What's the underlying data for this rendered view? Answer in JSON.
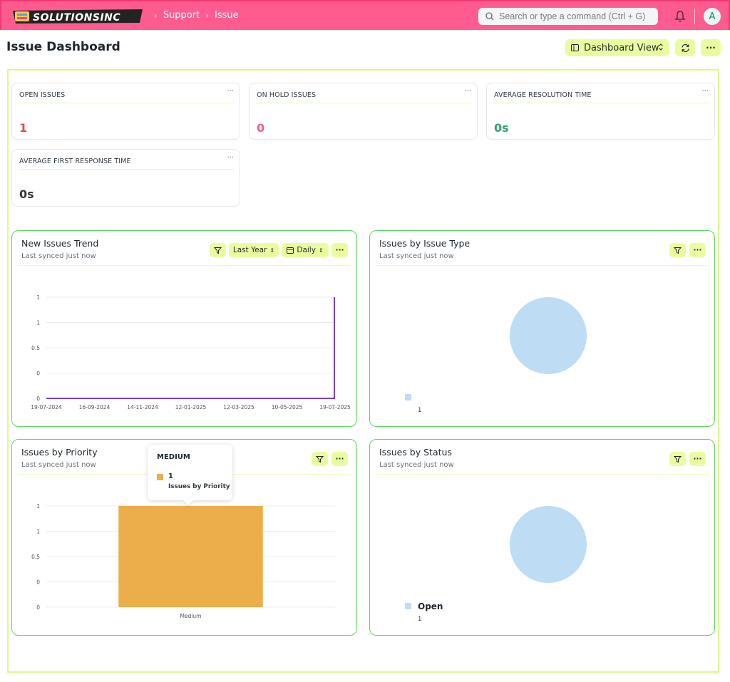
{
  "app": {
    "logo_text": "SOLUTIONSINC",
    "breadcrumbs": [
      "Support",
      "Issue"
    ],
    "search_placeholder": "Search or type a command (Ctrl + G)",
    "avatar_letter": "A"
  },
  "page": {
    "title": "Issue Dashboard",
    "view_label": "Dashboard View"
  },
  "number_cards": [
    {
      "label": "OPEN ISSUES",
      "value": "1",
      "color": "#e24c4c"
    },
    {
      "label": "ON HOLD ISSUES",
      "value": "0",
      "color": "#f25e8f"
    },
    {
      "label": "AVERAGE RESOLUTION TIME",
      "value": "0s",
      "color": "#30a66d"
    },
    {
      "label": "AVERAGE FIRST RESPONSE TIME",
      "value": "0s",
      "color": "#383838"
    }
  ],
  "charts": {
    "trend": {
      "title": "New Issues Trend",
      "synced": "Last synced just now",
      "range_label": "Last Year",
      "interval_label": "Daily"
    },
    "type": {
      "title": "Issues by Issue Type",
      "synced": "Last synced just now"
    },
    "priority": {
      "title": "Issues by Priority",
      "synced": "Last synced just now"
    },
    "status": {
      "title": "Issues by Status",
      "synced": "Last synced just now"
    }
  },
  "tooltip": {
    "title": "MEDIUM",
    "value": "1",
    "series": "Issues by Priority"
  },
  "chart_data": [
    {
      "type": "line",
      "title": "New Issues Trend",
      "x": [
        "19-07-2024",
        "16-09-2024",
        "14-11-2024",
        "12-01-2025",
        "12-03-2025",
        "10-05-2025",
        "19-07-2025"
      ],
      "series": [
        {
          "values": [
            0,
            0,
            0,
            0,
            0,
            0,
            1
          ],
          "color": "#7b3fc9"
        }
      ],
      "ytick_labels": [
        "0",
        "0",
        "0.5",
        "1",
        "1"
      ],
      "ylim": [
        0,
        1
      ],
      "grid": true
    },
    {
      "type": "pie",
      "title": "Issues by Issue Type",
      "categories": [
        ""
      ],
      "values": [
        1
      ],
      "value_labels": [
        "1"
      ],
      "color": "#bfdcf5"
    },
    {
      "type": "bar",
      "title": "Issues by Priority",
      "categories": [
        "Medium"
      ],
      "series": [
        {
          "name": "Issues by Priority",
          "values": [
            1
          ],
          "color": "#ecad4b"
        }
      ],
      "ytick_labels": [
        "0",
        "0",
        "0.5",
        "1",
        "1"
      ],
      "ylim": [
        0,
        1
      ],
      "grid": true
    },
    {
      "type": "pie",
      "title": "Issues by Status",
      "categories": [
        "Open"
      ],
      "values": [
        1
      ],
      "value_labels": [
        "1"
      ],
      "color": "#bfdcf5"
    }
  ]
}
